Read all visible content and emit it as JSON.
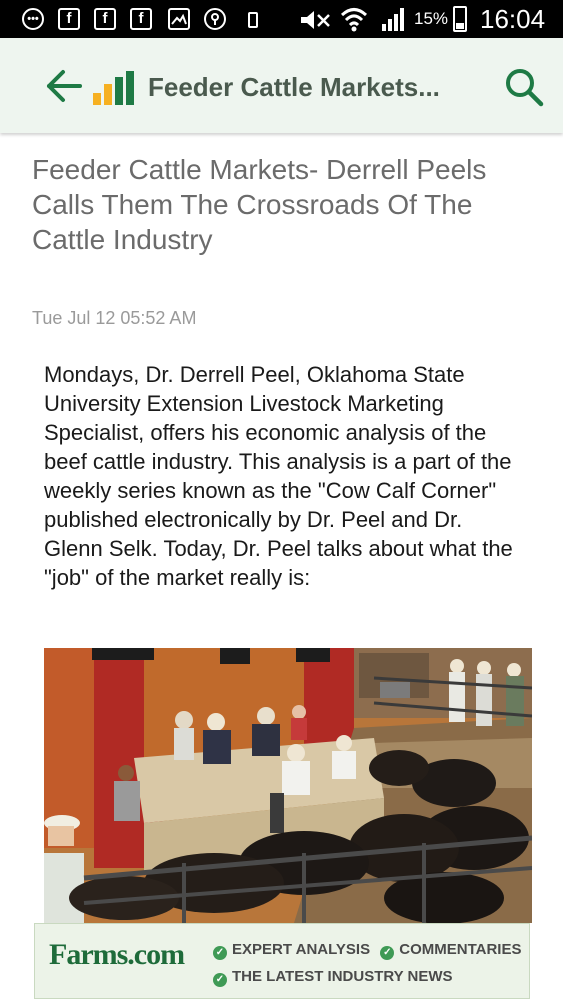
{
  "status_bar": {
    "battery_percent": "15%",
    "time": "16:04",
    "left_icons": [
      "chat-icon",
      "facebook-icon",
      "facebook-icon",
      "facebook-icon",
      "image-icon",
      "location-icon",
      "phone-icon"
    ],
    "right_icons": [
      "mute-icon",
      "wifi-icon",
      "signal-icon",
      "battery-icon"
    ]
  },
  "app_bar": {
    "title": "Feeder Cattle Markets...",
    "back_icon": "back-arrow-icon",
    "logo_icon": "bar-chart-logo-icon",
    "search_icon": "search-icon",
    "accent_color": "#1e7a45"
  },
  "article": {
    "headline": "Feeder Cattle Markets- Derrell Peels Calls Them The Crossroads Of The Cattle Industry",
    "date": "Tue Jul 12 05:52 AM",
    "body": "Mondays, Dr. Derrell Peel, Oklahoma State University Extension Livestock Marketing Specialist, offers his economic analysis of the beef cattle industry. This analysis is a part of the weekly series known as the \"Cow Calf Corner\" published electronically by Dr. Peel and Dr. Glenn Selk. Today, Dr. Peel talks about what the \"job\" of the market really is:"
  },
  "ad": {
    "brand": "Farms.com",
    "line1a": "EXPERT ANALYSIS",
    "line1b": "COMMENTARIES",
    "line2": "THE LATEST INDUSTRY NEWS"
  }
}
